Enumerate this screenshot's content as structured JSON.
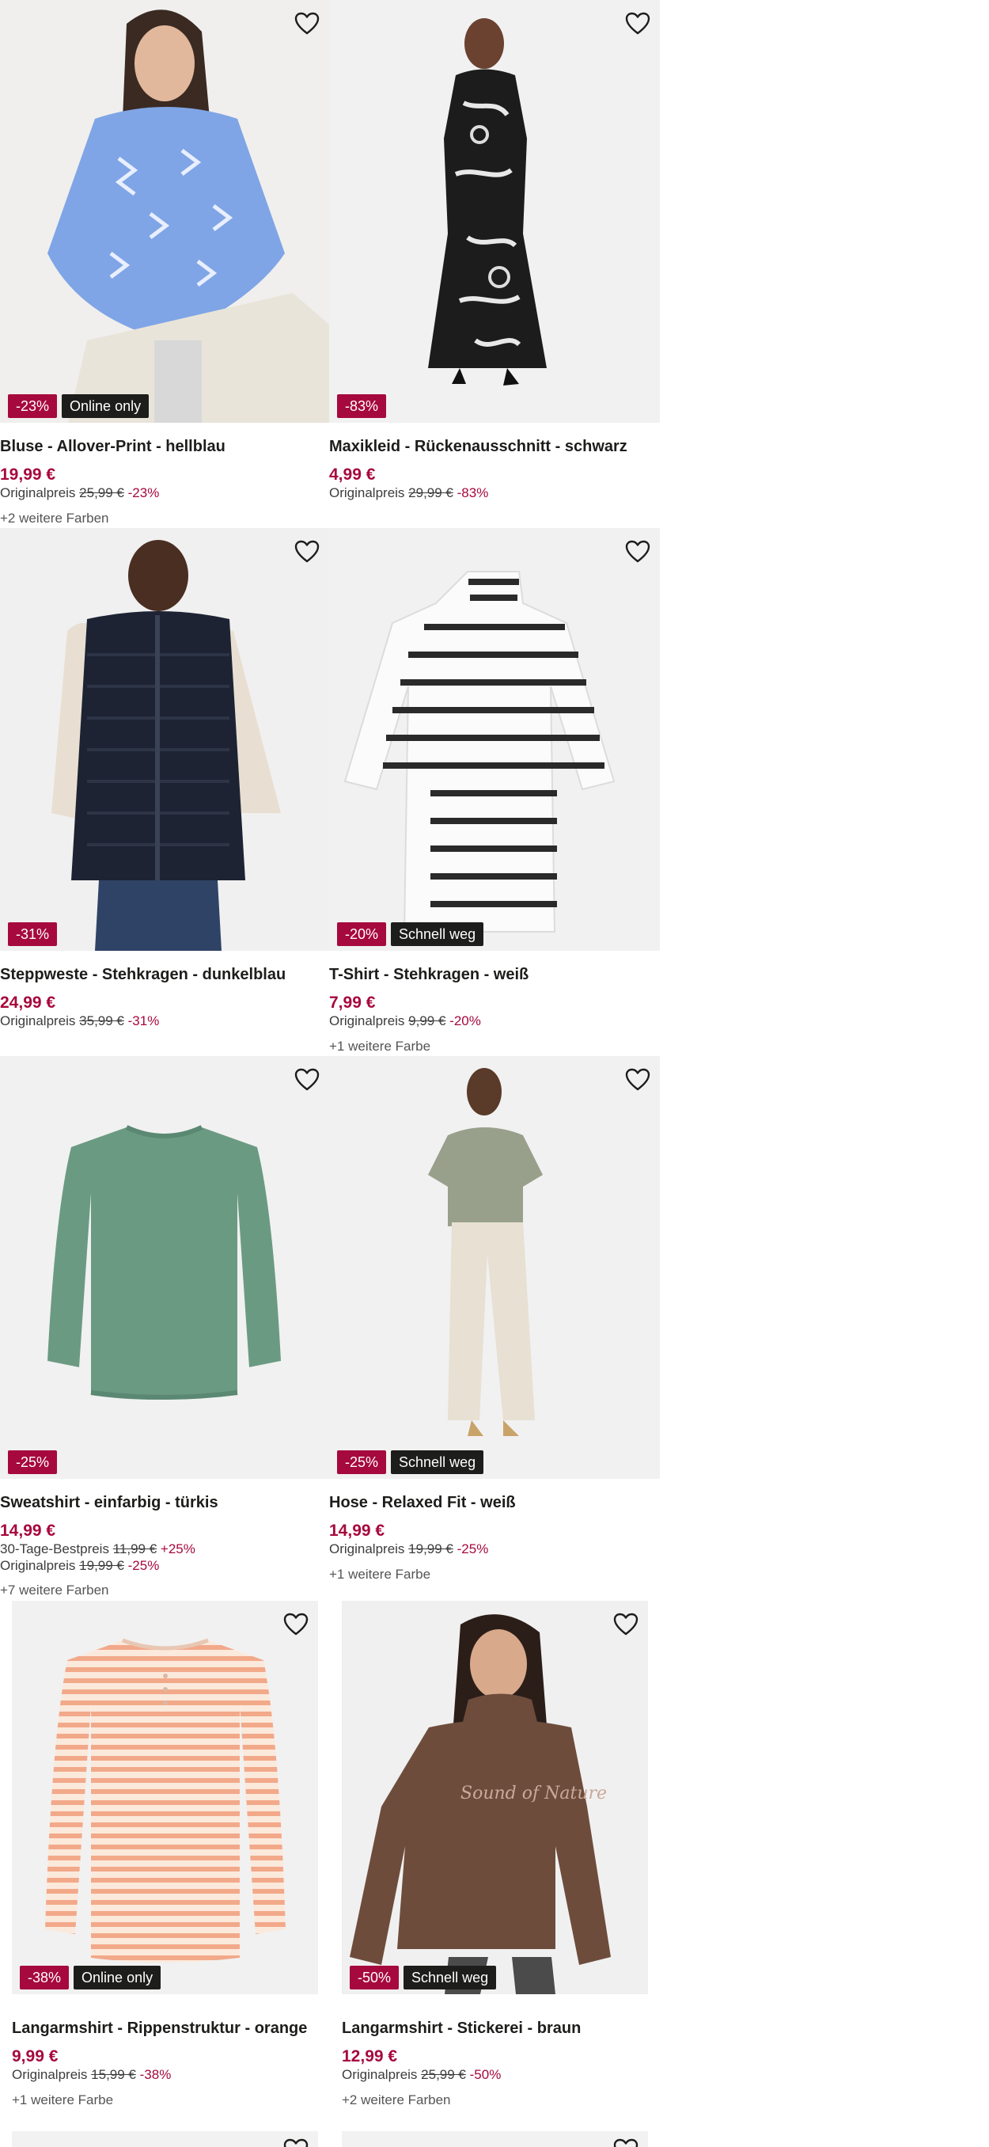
{
  "products": [
    {
      "title": "Bluse - Allover-Print - hellblau",
      "price": "19,99 €",
      "orig_label": "Originalpreis",
      "orig_price": "25,99 €",
      "orig_pct": "-23%",
      "more_colors": "+2 weitere Farben",
      "badge_sale": "-23%",
      "badge_extra": "Online only"
    },
    {
      "title": "Maxikleid - Rückenausschnitt - schwarz",
      "price": "4,99 €",
      "orig_label": "Originalpreis",
      "orig_price": "29,99 €",
      "orig_pct": "-83%",
      "badge_sale": "-83%"
    },
    {
      "title": "Steppweste - Stehkragen - dunkelblau",
      "price": "24,99 €",
      "orig_label": "Originalpreis",
      "orig_price": "35,99 €",
      "orig_pct": "-31%",
      "badge_sale": "-31%"
    },
    {
      "title": "T-Shirt - Stehkragen - weiß",
      "price": "7,99 €",
      "orig_label": "Originalpreis",
      "orig_price": "9,99 €",
      "orig_pct": "-20%",
      "more_colors": "+1 weitere Farbe",
      "badge_sale": "-20%",
      "badge_extra": "Schnell weg"
    },
    {
      "title": "Sweatshirt - einfarbig - türkis",
      "price": "14,99 €",
      "best_label": "30-Tage-Bestpreis",
      "best_price": "11,99 €",
      "best_pct": "+25%",
      "orig_label": "Originalpreis",
      "orig_price": "19,99 €",
      "orig_pct": "-25%",
      "more_colors": "+7 weitere Farben",
      "badge_sale": "-25%"
    },
    {
      "title": "Hose - Relaxed Fit - weiß",
      "price": "14,99 €",
      "orig_label": "Originalpreis",
      "orig_price": "19,99 €",
      "orig_pct": "-25%",
      "more_colors": "+1 weitere Farbe",
      "badge_sale": "-25%",
      "badge_extra": "Schnell weg"
    },
    {
      "title": "Langarmshirt - Rippenstruktur - orange",
      "price": "9,99 €",
      "orig_label": "Originalpreis",
      "orig_price": "15,99 €",
      "orig_pct": "-38%",
      "more_colors": "+1 weitere Farbe",
      "badge_sale": "-38%",
      "badge_extra": "Online only"
    },
    {
      "title": "Langarmshirt - Stickerei - braun",
      "price": "12,99 €",
      "orig_label": "Originalpreis",
      "orig_price": "25,99 €",
      "orig_pct": "-50%",
      "more_colors": "+2 weitere Farben",
      "badge_sale": "-50%",
      "badge_extra": "Schnell weg",
      "print_text": "Sound of Nature"
    }
  ],
  "icons": {
    "favorite": "heart-outline-icon"
  },
  "colors": {
    "sale": "#a6093d",
    "badge_dark": "#1d1d1b",
    "image_bg": "#f2f2f2"
  }
}
